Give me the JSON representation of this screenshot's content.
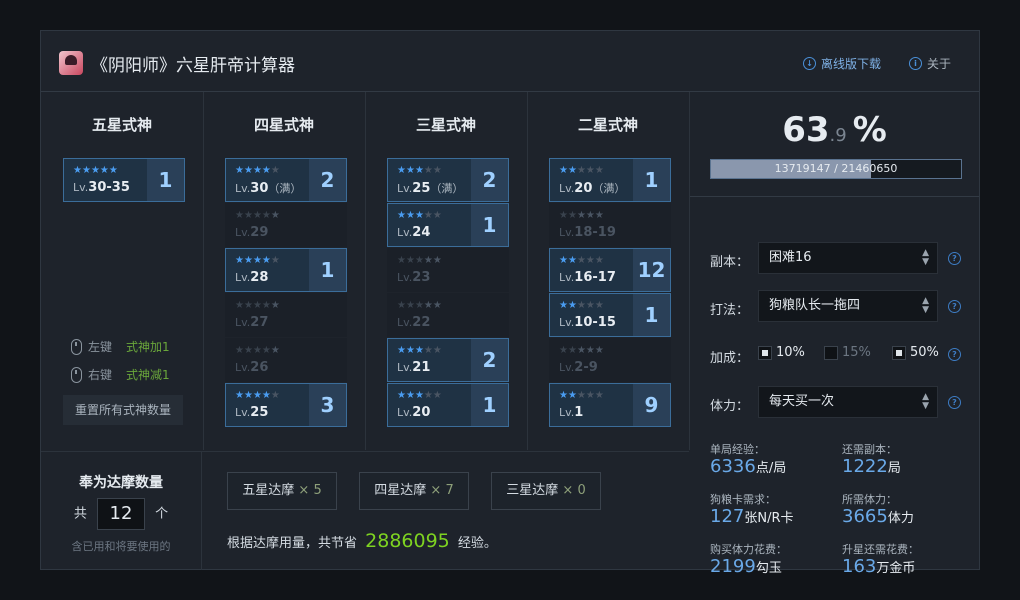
{
  "header": {
    "title": "《阴阳师》六星肝帝计算器",
    "download_label": "离线版下载",
    "about_label": "关于"
  },
  "columns": [
    {
      "title": "五星式神",
      "stars_total": 5,
      "cards": [
        {
          "stars": 5,
          "lv": "30-35",
          "lv_note": "",
          "count": "1",
          "active": true
        }
      ]
    },
    {
      "title": "四星式神",
      "stars_total": 5,
      "cards": [
        {
          "stars": 4,
          "lv": "30",
          "lv_note": "（满）",
          "count": "2",
          "active": true
        },
        {
          "stars": 4,
          "lv": "29",
          "lv_note": "",
          "count": "",
          "active": false
        },
        {
          "stars": 4,
          "lv": "28",
          "lv_note": "",
          "count": "1",
          "active": true
        },
        {
          "stars": 4,
          "lv": "27",
          "lv_note": "",
          "count": "",
          "active": false
        },
        {
          "stars": 4,
          "lv": "26",
          "lv_note": "",
          "count": "",
          "active": false
        },
        {
          "stars": 4,
          "lv": "25",
          "lv_note": "",
          "count": "3",
          "active": true
        }
      ]
    },
    {
      "title": "三星式神",
      "stars_total": 5,
      "cards": [
        {
          "stars": 3,
          "lv": "25",
          "lv_note": "（满）",
          "count": "2",
          "active": true
        },
        {
          "stars": 3,
          "lv": "24",
          "lv_note": "",
          "count": "1",
          "active": true
        },
        {
          "stars": 3,
          "lv": "23",
          "lv_note": "",
          "count": "",
          "active": false
        },
        {
          "stars": 3,
          "lv": "22",
          "lv_note": "",
          "count": "",
          "active": false
        },
        {
          "stars": 3,
          "lv": "21",
          "lv_note": "",
          "count": "2",
          "active": true
        },
        {
          "stars": 3,
          "lv": "20",
          "lv_note": "",
          "count": "1",
          "active": true
        }
      ]
    },
    {
      "title": "二星式神",
      "stars_total": 5,
      "cards": [
        {
          "stars": 2,
          "lv": "20",
          "lv_note": "（满）",
          "count": "1",
          "active": true
        },
        {
          "stars": 2,
          "lv": "18-19",
          "lv_note": "",
          "count": "",
          "active": false
        },
        {
          "stars": 2,
          "lv": "16-17",
          "lv_note": "",
          "count": "12",
          "active": true
        },
        {
          "stars": 2,
          "lv": "10-15",
          "lv_note": "",
          "count": "1",
          "active": true
        },
        {
          "stars": 2,
          "lv": "2-9",
          "lv_note": "",
          "count": "",
          "active": false
        },
        {
          "stars": 2,
          "lv": "1",
          "lv_note": "",
          "count": "9",
          "active": true
        }
      ]
    }
  ],
  "lv_prefix": "Lv.",
  "hints": {
    "left_key": "左键",
    "left_action": "式神加1",
    "right_key": "右键",
    "right_action": "式神减1",
    "reset_label": "重置所有式神数量"
  },
  "daruma": {
    "title": "奉为达摩数量",
    "prefix": "共",
    "value": "12",
    "suffix": "个",
    "note": "含已用和将要使用的",
    "items": [
      {
        "label": "五星达摩",
        "mult": "× 5"
      },
      {
        "label": "四星达摩",
        "mult": "× 7"
      },
      {
        "label": "三星达摩",
        "mult": "× 0"
      }
    ],
    "saving_prefix": "根据达摩用量，共节省",
    "saving_value": "2886095",
    "saving_suffix": "经验。"
  },
  "progress": {
    "percent_int": "63",
    "percent_dec": ".9",
    "percent_sign": "%",
    "fraction": 0.639,
    "text": "13719147 / 21460650"
  },
  "settings": {
    "dungeon_label": "副本：",
    "dungeon_value": "困难16",
    "method_label": "打法：",
    "method_value": "狗粮队长一拖四",
    "bonus_label": "加成：",
    "bonus_options": [
      {
        "label": "10%",
        "checked": true
      },
      {
        "label": "15%",
        "checked": false
      },
      {
        "label": "50%",
        "checked": true
      }
    ],
    "stamina_label": "体力：",
    "stamina_value": "每天买一次"
  },
  "stats": [
    {
      "label": "单局经验：",
      "value": "6336",
      "unit": "点/局"
    },
    {
      "label": "还需副本：",
      "value": "1222",
      "unit": "局"
    },
    {
      "label": "狗粮卡需求：",
      "value": "127",
      "unit": "张N/R卡"
    },
    {
      "label": "所需体力：",
      "value": "3665",
      "unit": "体力"
    },
    {
      "label": "购买体力花费：",
      "value": "2199",
      "unit": "勾玉"
    },
    {
      "label": "升星还需花费：",
      "value": "163",
      "unit": "万金币"
    }
  ],
  "colors": {
    "accent_blue": "#4a9cf0",
    "green_value": "#7ed321",
    "progress_fill": "#8a97ad"
  }
}
